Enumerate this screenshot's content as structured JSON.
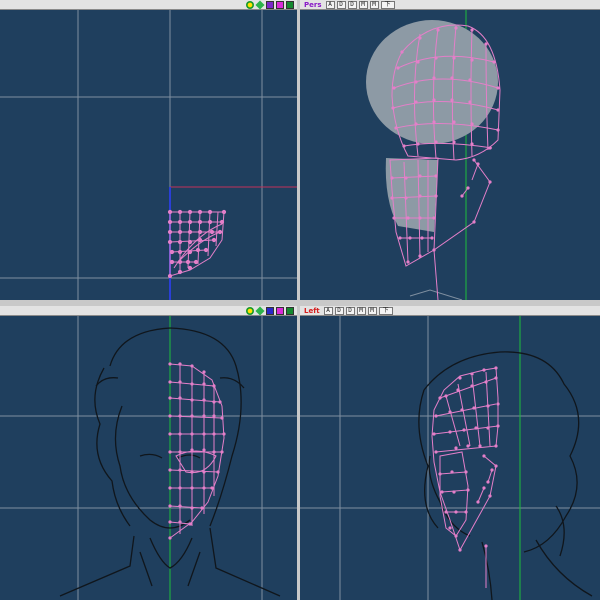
{
  "colors": {
    "viewport_bg": "#1f3f5e",
    "grid": "#7f8fa0",
    "mesh": "#e47fc9",
    "x_axis": "#c0305a",
    "y_axis": "#1ebe3c",
    "z_axis": "#2a3fd6",
    "sketch": "#10161c",
    "head_shade": "#8d9aa5"
  },
  "viewports": {
    "top": {
      "toolbar": {
        "icons": [
          "zoom-icon",
          "pan-icon",
          "color-swatch-purple-icon",
          "color-swatch-magenta-icon",
          "color-swatch-green-icon"
        ]
      }
    },
    "perspective": {
      "toolbar": {
        "label": "Pers",
        "buttons": [
          "A",
          "D",
          "D",
          "M",
          "M",
          "下"
        ]
      }
    },
    "front": {
      "toolbar": {
        "icons": [
          "zoom-icon",
          "pan-icon",
          "color-swatch-purple-icon",
          "color-swatch-magenta-icon",
          "color-swatch-green-icon"
        ]
      }
    },
    "left": {
      "toolbar": {
        "label": "Left",
        "buttons": [
          "A",
          "D",
          "D",
          "M",
          "M",
          "下"
        ]
      }
    }
  }
}
